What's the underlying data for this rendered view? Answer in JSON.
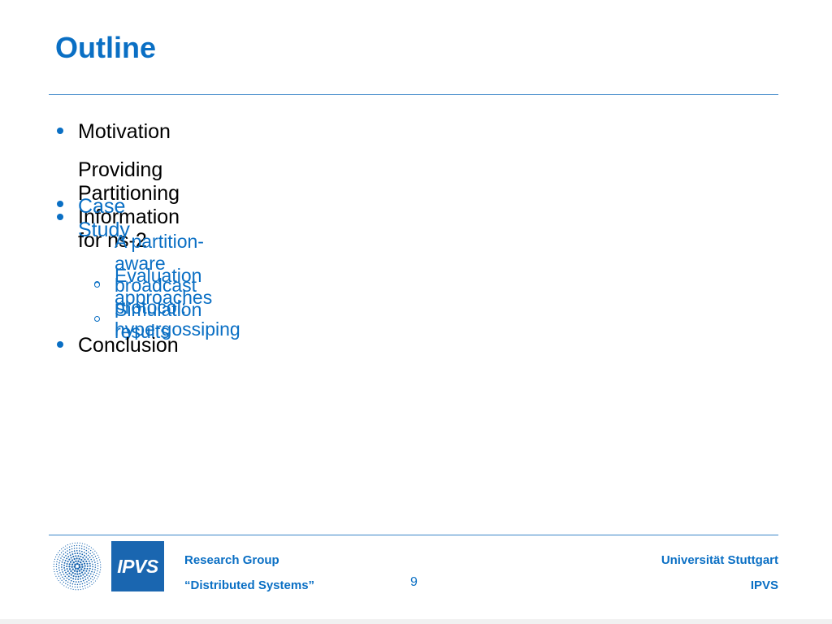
{
  "slide": {
    "title": "Outline",
    "accent_color": "#0a6fc4",
    "bullets": [
      {
        "text": "Motivation",
        "highlighted": false
      },
      {
        "text": "Providing Partitioning Information for ns-2",
        "highlighted": false
      },
      {
        "text": "Case Study",
        "highlighted": true,
        "subitems": [
          "A partition-aware broadcast protocol: hypergossiping",
          "Evaluation approaches",
          "Simulation results"
        ]
      },
      {
        "text": "Conclusion",
        "highlighted": false
      }
    ]
  },
  "footer": {
    "group_line1": "Research Group",
    "group_line2": "“Distributed Systems”",
    "page_number": "9",
    "university": "Universität Stuttgart",
    "institute": "IPVS",
    "logo_text": "IPVS",
    "university_logo_icon": "university-stuttgart-dot-logo"
  }
}
